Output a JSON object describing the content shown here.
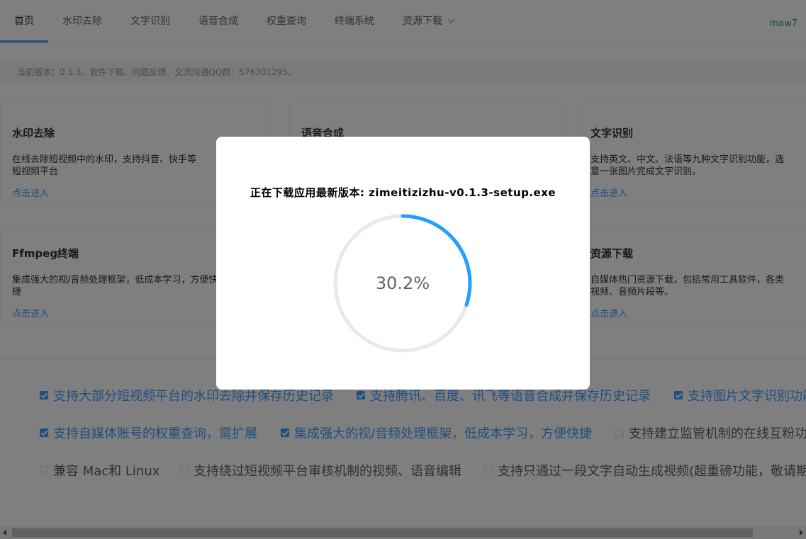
{
  "nav": {
    "items": [
      "首页",
      "水印去除",
      "文字识别",
      "语音合成",
      "权重查询",
      "终端系统",
      "资源下载"
    ],
    "user": "maw7"
  },
  "notice": "当前版本：0.1.3。软件下载、问题反馈、交流沟通QQ群：576301295。",
  "cards": [
    {
      "title": "水印去除",
      "desc": "在线去除短视频中的水印，支持抖音、快手等\n短视频平台",
      "link": "点击进入"
    },
    {
      "title": "语音合成",
      "desc": "",
      "link": ""
    },
    {
      "title": "文字识别",
      "desc": "支持英文、中文、法语等九种文字识别功能，选\n意一张图片完成文字识别。",
      "link": "点击进入"
    },
    {
      "title": "Ffmpeg终端",
      "desc": "集成强大的视/音频处理框架，低成本学习，方便快\n捷",
      "link": "点击进入"
    },
    {
      "title": "资源下载",
      "desc": "自媒体热门资源下载，包括常用工具软件，各类\n视频、音频片段等。",
      "link": "点击进入"
    }
  ],
  "features": [
    {
      "label": "支持大部分短视频平台的水印去除并保存历史记录",
      "checked": true
    },
    {
      "label": "支持腾讯、百度、讯飞等语音合成并保存历史记录",
      "checked": true
    },
    {
      "label": "支持图片文字识别功能",
      "checked": true
    },
    {
      "label": "支持自媒体账号的权重查询，需扩展",
      "checked": true
    },
    {
      "label": "集成强大的视/音频处理框架，低成本学习，方便快捷",
      "checked": true
    },
    {
      "label": "支持建立监管机制的在线互粉功能",
      "checked": false
    },
    {
      "label": "兼容 Mac和 Linux",
      "checked": false
    },
    {
      "label": "支持绕过短视频平台审核机制的视频、语音编辑",
      "checked": false
    },
    {
      "label": "支持只通过一段文字自动生成视频(超重磅功能，敬请期待)",
      "checked": false
    }
  ],
  "dialog": {
    "title": "正在下载应用最新版本: zimeitizizhu-v0.1.3-setup.exe",
    "progress_text": "30.2%",
    "progress": 0.302
  },
  "colors": {
    "accent": "#409eff",
    "progress_arc": "#20a0ff",
    "track": "#e5e9f2",
    "user": "#2b9c7a"
  }
}
